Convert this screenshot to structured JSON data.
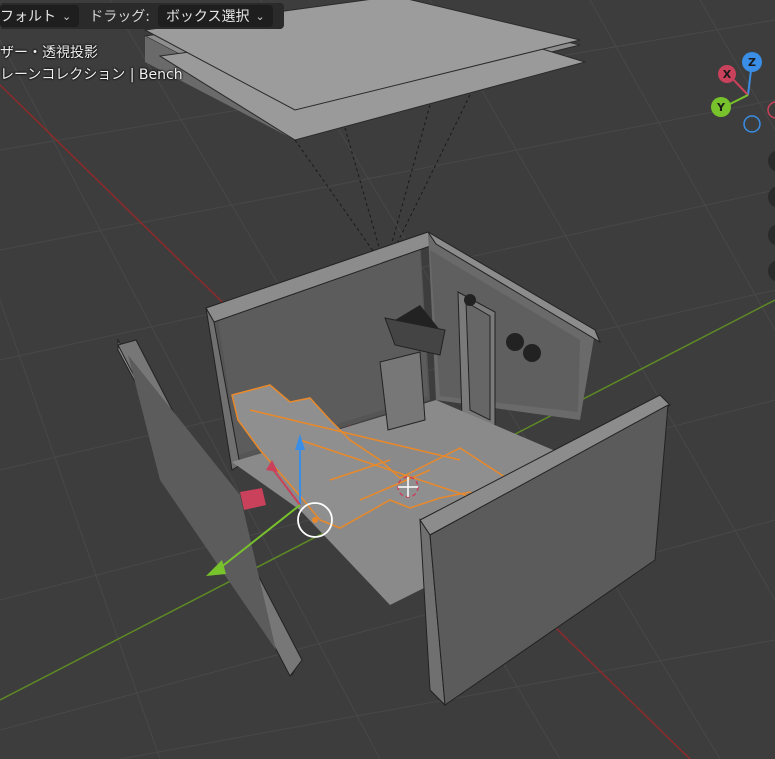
{
  "header": {
    "mode_dropdown_label": "フォルト",
    "drag_label": "ドラッグ:",
    "drag_dropdown_label": "ボックス選択"
  },
  "overlay": {
    "view_text": "ザー・透視投影",
    "collection_text": "レーンコレクション | Bench"
  },
  "gizmo": {
    "z_label": "Z",
    "x_label": "X",
    "y_label": "Y",
    "colors": {
      "x": "#c9415a",
      "y": "#78c22c",
      "z": "#3a8ee6"
    }
  },
  "colors": {
    "background": "#3d3d3d",
    "grid": "#4a4a4a",
    "x_axis": "#8e2a2a",
    "y_axis": "#5e8a24",
    "selection": "#e8892b"
  }
}
